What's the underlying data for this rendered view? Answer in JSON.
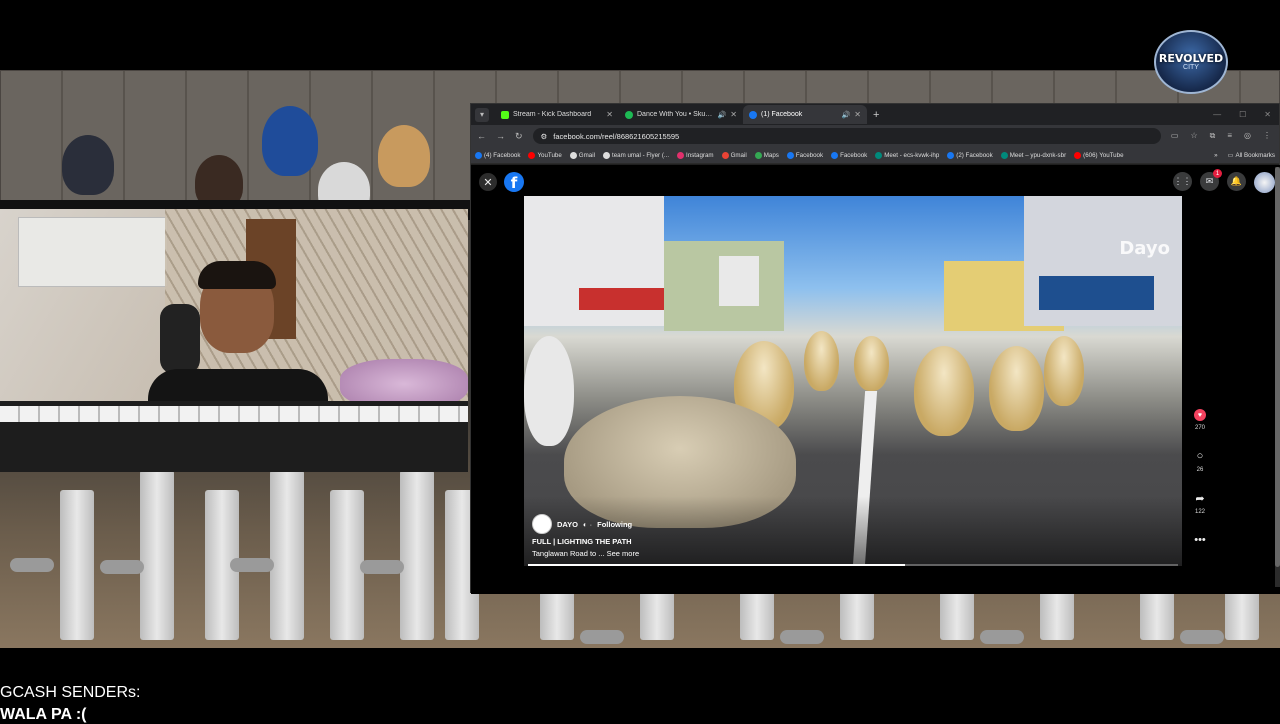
{
  "logo": {
    "text": "REVOLVED",
    "sub": "CITY"
  },
  "browser": {
    "tabs": [
      {
        "label": "Stream - Kick Dashboard",
        "color": "#53fc18",
        "active": false,
        "sound": false
      },
      {
        "label": "Dance With You • Skusta Clee",
        "color": "#1db954",
        "active": false,
        "sound": true
      },
      {
        "label": "(1) Facebook",
        "color": "#1877f2",
        "active": true,
        "sound": true
      }
    ],
    "url": "facebook.com/reel/868621605215595",
    "bookmarks": [
      {
        "label": "(4) Facebook",
        "color": "#1877f2"
      },
      {
        "label": "YouTube",
        "color": "#ff0000"
      },
      {
        "label": "Gmail",
        "color": "#ffffff"
      },
      {
        "label": "team umal - Flyer (...",
        "color": "#ffffff"
      },
      {
        "label": "Instagram",
        "color": "#e1306c"
      },
      {
        "label": "Gmail",
        "color": "#ea4335"
      },
      {
        "label": "Maps",
        "color": "#34a853"
      },
      {
        "label": "Facebook",
        "color": "#1877f2"
      },
      {
        "label": "Facebook",
        "color": "#1877f2"
      },
      {
        "label": "Meet - ecs-kvwk-ihp",
        "color": "#00897b"
      },
      {
        "label": "(2) Facebook",
        "color": "#1877f2"
      },
      {
        "label": "Meet – ypu-dxnk-sbr",
        "color": "#00897b"
      },
      {
        "label": "(606) YouTube",
        "color": "#ff0000"
      }
    ],
    "all_bookmarks": "All Bookmarks"
  },
  "facebook": {
    "notification_count": "1",
    "reel": {
      "channel": "DAYO",
      "follow_status": "Following",
      "title": "FULL | LIGHTING THE PATH",
      "description": "Tanglawan Road to ... See more",
      "watermark": "Dayo",
      "progress": 0.58
    },
    "actions": {
      "likes": "270",
      "comments": "26",
      "shares": "122"
    }
  },
  "overlay": {
    "gcash_label": "GCASH SENDERs:",
    "gcash_value": "WALA PA :("
  }
}
